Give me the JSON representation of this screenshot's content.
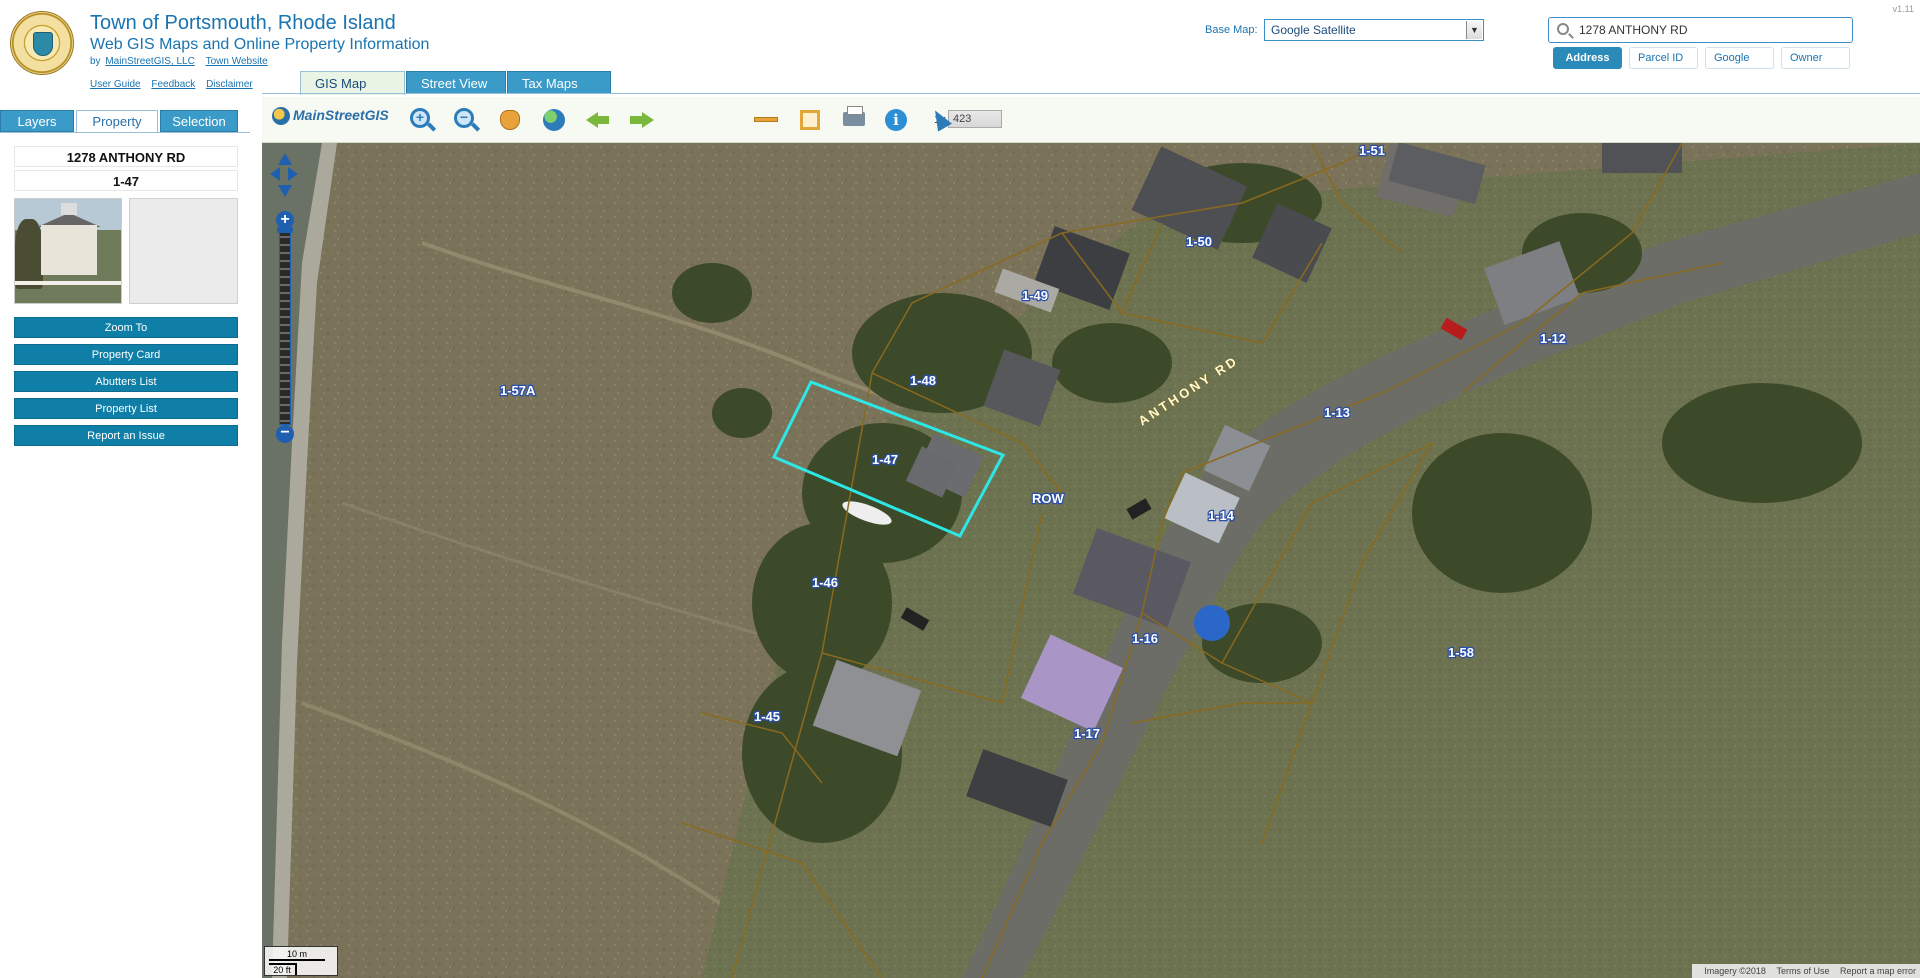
{
  "header": {
    "town_title": "Town of Portsmouth, Rhode Island",
    "subtitle": "Web GIS Maps and Online Property Information",
    "byline_prefix": "by",
    "byline_company": "MainStreetGIS, LLC",
    "byline_website": "Town Website",
    "help_links": [
      "User Guide",
      "Feedback",
      "Disclaimer"
    ],
    "version": "v1.11"
  },
  "basemap": {
    "label": "Base Map:",
    "selected": "Google Satellite"
  },
  "search": {
    "value": "1278 ANTHONY RD",
    "modes": [
      "Address",
      "Parcel ID",
      "Google",
      "Owner"
    ],
    "active_mode": "Address"
  },
  "map_tabs": [
    "GIS Map",
    "Street View",
    "Tax Maps"
  ],
  "active_map_tab": "GIS Map",
  "panel_tabs": [
    "Layers",
    "Property",
    "Selection"
  ],
  "active_panel_tab": "Property",
  "property": {
    "address": "1278 ANTHONY RD",
    "parcel_id": "1-47"
  },
  "actions": [
    "Zoom To",
    "Property Card",
    "Abutters List",
    "Property List",
    "Report an Issue"
  ],
  "toolbar": {
    "logo": "MainStreetGIS",
    "scale_prefix": "1 :",
    "scale_value": "423",
    "tools": [
      "zoom-in-icon",
      "zoom-out-icon",
      "pan-hand-icon",
      "full-extent-globe-icon",
      "back-arrow-icon",
      "forward-arrow-icon",
      "measure-line-icon",
      "measure-area-icon",
      "print-icon",
      "identify-info-icon",
      "select-pointer-icon"
    ]
  },
  "map": {
    "parcels": [
      "1-51",
      "1-50",
      "1-49",
      "1-48",
      "1-47",
      "1-46",
      "1-45",
      "1-57A",
      "1-13",
      "1-14",
      "1-12",
      "1-16",
      "1-17",
      "1-58"
    ],
    "road_label": "ANTHONY RD",
    "row_label": "ROW",
    "selected_parcel": "1-47",
    "selection_color": "#2ee6e6",
    "parcel_line_color": "#8a6a1e",
    "label_outline_color": "#2a4fa8",
    "scale_bar_metric": "10 m",
    "scale_bar_imperial": "20 ft",
    "attribution": [
      "Imagery ©2018",
      "Terms of Use",
      "Report a map error"
    ]
  },
  "colors": {
    "brand_blue": "#1a74b0",
    "button_teal": "#0f7fa8",
    "tab_blue": "#3a9bc8"
  }
}
